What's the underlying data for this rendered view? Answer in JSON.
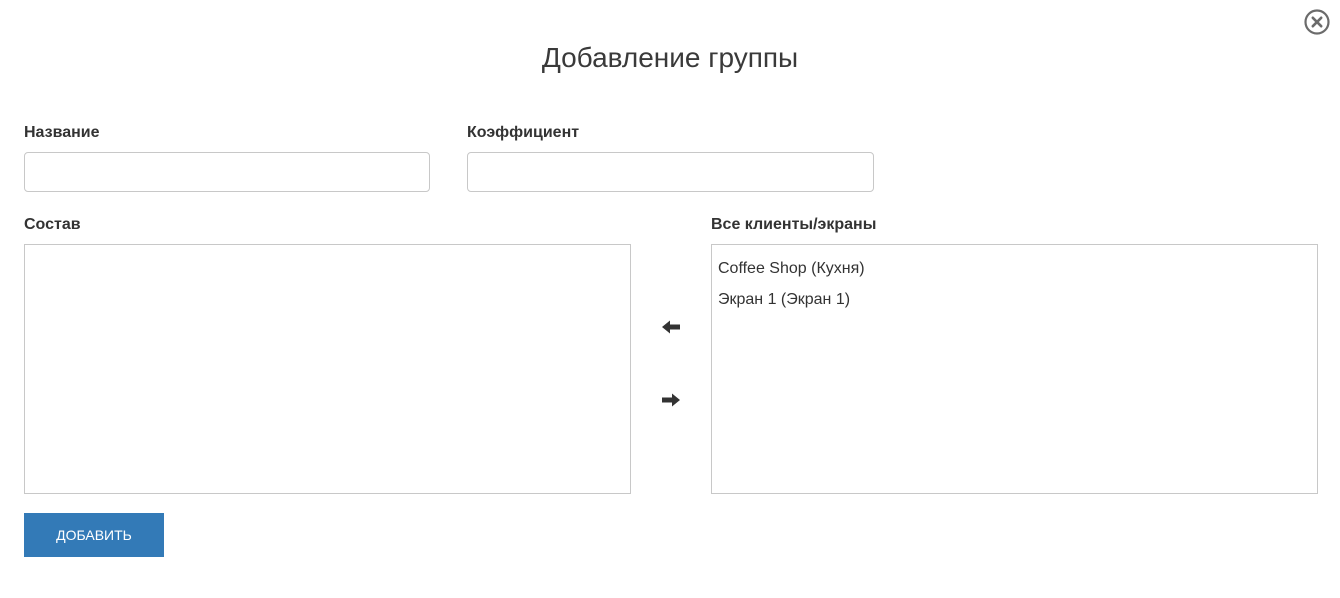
{
  "dialog": {
    "title": "Добавление группы",
    "close_icon": "close-circle-icon"
  },
  "form": {
    "name_label": "Название",
    "name_value": "",
    "coefficient_label": "Коэффициент",
    "coefficient_value": ""
  },
  "composition": {
    "label": "Состав",
    "items": []
  },
  "all_clients": {
    "label": "Все клиенты/экраны",
    "items": [
      "Coffee Shop (Кухня)",
      "Экран 1 (Экран 1)"
    ]
  },
  "transfer": {
    "move_left_icon": "arrow-left-icon",
    "move_right_icon": "arrow-right-icon"
  },
  "actions": {
    "add_label": "ДОБАВИТЬ",
    "accent_color": "#337ab7"
  }
}
